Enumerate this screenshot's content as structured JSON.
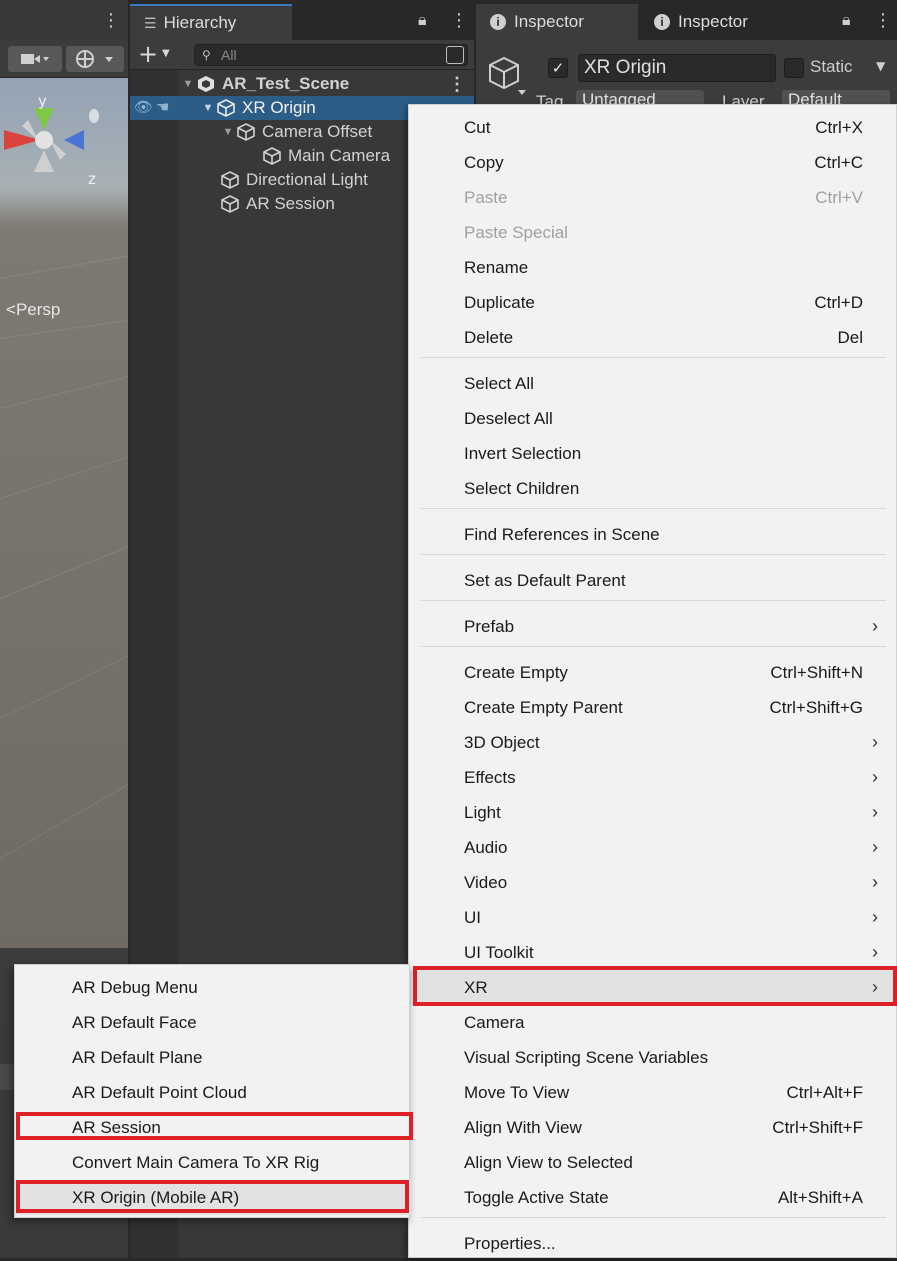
{
  "hierarchy": {
    "tab_title": "Hierarchy",
    "search_placeholder": "All",
    "scene_name": "AR_Test_Scene",
    "items": [
      {
        "label": "XR Origin"
      },
      {
        "label": "Camera Offset"
      },
      {
        "label": "Main Camera"
      },
      {
        "label": "Directional Light"
      },
      {
        "label": "AR Session"
      }
    ]
  },
  "scene_view": {
    "persp_label": "Persp",
    "axis_y": "y",
    "axis_z": "z"
  },
  "inspector": {
    "tabs": [
      "Inspector",
      "Inspector"
    ],
    "object_name": "XR Origin",
    "static_label": "Static",
    "tag_label": "Tag",
    "tag_value": "Untagged",
    "layer_label": "Layer",
    "layer_value": "Default"
  },
  "context_menu": {
    "items": [
      {
        "label": "Cut",
        "shortcut": "Ctrl+X"
      },
      {
        "label": "Copy",
        "shortcut": "Ctrl+C"
      },
      {
        "label": "Paste",
        "shortcut": "Ctrl+V"
      },
      {
        "label": "Paste Special",
        "shortcut": ""
      },
      {
        "label": "Rename",
        "shortcut": ""
      },
      {
        "label": "Duplicate",
        "shortcut": "Ctrl+D"
      },
      {
        "label": "Delete",
        "shortcut": "Del"
      },
      {
        "label": "Select All",
        "shortcut": ""
      },
      {
        "label": "Deselect All",
        "shortcut": ""
      },
      {
        "label": "Invert Selection",
        "shortcut": ""
      },
      {
        "label": "Select Children",
        "shortcut": ""
      },
      {
        "label": "Find References in Scene",
        "shortcut": ""
      },
      {
        "label": "Set as Default Parent",
        "shortcut": ""
      },
      {
        "label": "Prefab",
        "shortcut": ""
      },
      {
        "label": "Create Empty",
        "shortcut": "Ctrl+Shift+N"
      },
      {
        "label": "Create Empty Parent",
        "shortcut": "Ctrl+Shift+G"
      },
      {
        "label": "3D Object",
        "shortcut": ""
      },
      {
        "label": "Effects",
        "shortcut": ""
      },
      {
        "label": "Light",
        "shortcut": ""
      },
      {
        "label": "Audio",
        "shortcut": ""
      },
      {
        "label": "Video",
        "shortcut": ""
      },
      {
        "label": "UI",
        "shortcut": ""
      },
      {
        "label": "UI Toolkit",
        "shortcut": ""
      },
      {
        "label": "XR",
        "shortcut": ""
      },
      {
        "label": "Camera",
        "shortcut": ""
      },
      {
        "label": "Visual Scripting Scene Variables",
        "shortcut": ""
      },
      {
        "label": "Move To View",
        "shortcut": "Ctrl+Alt+F"
      },
      {
        "label": "Align With View",
        "shortcut": "Ctrl+Shift+F"
      },
      {
        "label": "Align View to Selected",
        "shortcut": ""
      },
      {
        "label": "Toggle Active State",
        "shortcut": "Alt+Shift+A"
      },
      {
        "label": "Properties...",
        "shortcut": ""
      }
    ],
    "submenu_arrow": "›"
  },
  "xr_submenu": {
    "items": [
      {
        "label": "AR Debug Menu"
      },
      {
        "label": "AR Default Face"
      },
      {
        "label": "AR Default Plane"
      },
      {
        "label": "AR Default Point Cloud"
      },
      {
        "label": "AR Session"
      },
      {
        "label": "Convert Main Camera To XR Rig"
      },
      {
        "label": "XR Origin (Mobile AR)"
      }
    ]
  },
  "colors": {
    "highlight_border": "#dd1f26",
    "selection": "#2c5d87",
    "menu_bg": "#f2f2f2"
  }
}
